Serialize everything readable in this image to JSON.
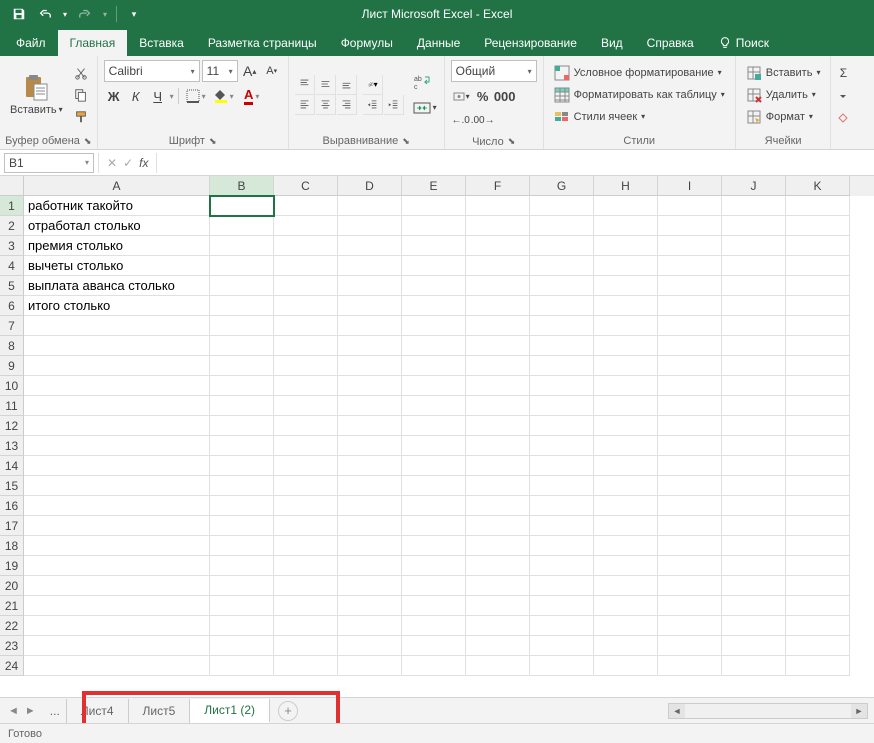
{
  "title": "Лист Microsoft Excel  -  Excel",
  "tabs": {
    "file": "Файл",
    "home": "Главная",
    "insert": "Вставка",
    "layout": "Разметка страницы",
    "formulas": "Формулы",
    "data": "Данные",
    "review": "Рецензирование",
    "view": "Вид",
    "help": "Справка",
    "search": "Поиск"
  },
  "ribbon": {
    "clipboard": {
      "label": "Буфер обмена",
      "paste": "Вставить"
    },
    "font": {
      "label": "Шрифт",
      "name": "Calibri",
      "size": "11"
    },
    "align": {
      "label": "Выравнивание"
    },
    "number": {
      "label": "Число",
      "format": "Общий"
    },
    "styles": {
      "label": "Стили",
      "cond": "Условное форматирование",
      "table": "Форматировать как таблицу",
      "cell": "Стили ячеек"
    },
    "cells": {
      "label": "Ячейки",
      "insert": "Вставить",
      "delete": "Удалить",
      "format": "Формат"
    }
  },
  "namebox": "B1",
  "columns": [
    "A",
    "B",
    "C",
    "D",
    "E",
    "F",
    "G",
    "H",
    "I",
    "J",
    "K"
  ],
  "selected": {
    "col": "B",
    "row": 1
  },
  "rows": [
    "работник такойто",
    "отработал столько",
    "премия столько",
    "вычеты столько",
    "выплата аванса столько",
    "итого столько",
    "",
    "",
    "",
    "",
    "",
    "",
    "",
    "",
    "",
    "",
    "",
    "",
    "",
    "",
    "",
    "",
    "",
    ""
  ],
  "sheets": [
    {
      "name": "Лист4",
      "active": false
    },
    {
      "name": "Лист5",
      "active": false
    },
    {
      "name": "Лист1 (2)",
      "active": true
    }
  ],
  "status": "Готово"
}
